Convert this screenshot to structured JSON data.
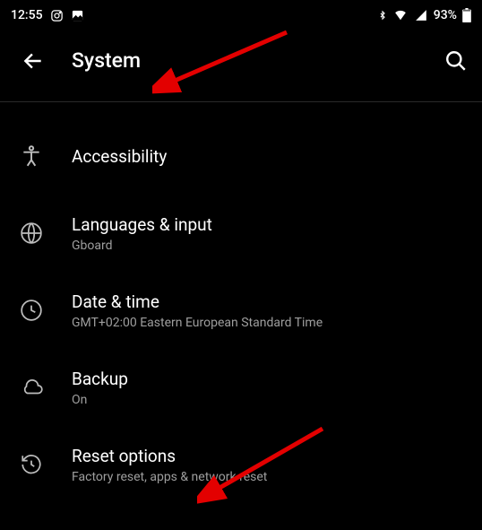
{
  "status": {
    "time": "12:55",
    "battery": "93%"
  },
  "header": {
    "title": "System"
  },
  "rows": [
    {
      "label": "Accessibility",
      "sub": ""
    },
    {
      "label": "Languages & input",
      "sub": "Gboard"
    },
    {
      "label": "Date & time",
      "sub": "GMT+02:00 Eastern European Standard Time"
    },
    {
      "label": "Backup",
      "sub": "On"
    },
    {
      "label": "Reset options",
      "sub": "Factory reset, apps & network reset"
    }
  ]
}
